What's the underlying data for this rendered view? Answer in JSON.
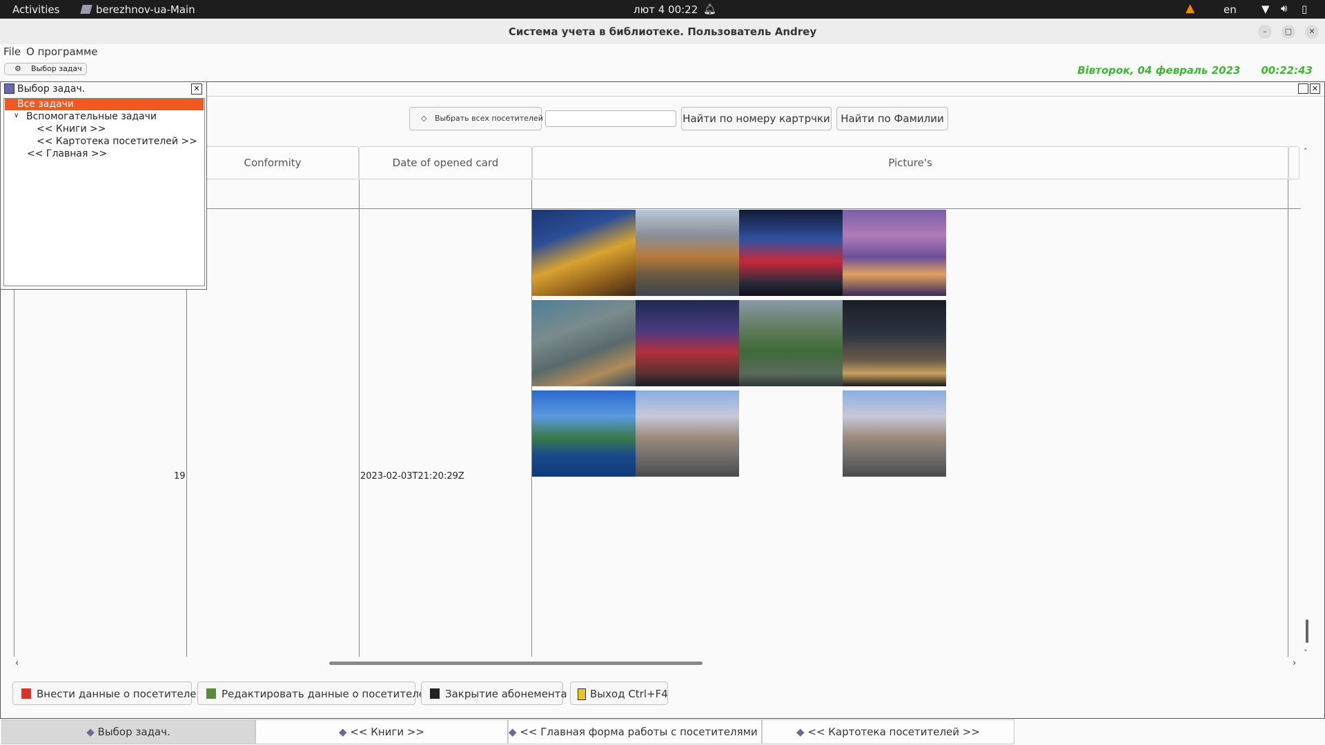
{
  "system": {
    "activities": "Activities",
    "app_name": "berezhnov-ua-Main",
    "clock": "лют 4  00:22",
    "keyboard_layout": "en"
  },
  "window": {
    "title": "Система учета в библиотеке. Пользователь Andrey"
  },
  "menu": {
    "file": "File",
    "about": "О программе"
  },
  "toolbar": {
    "task_select_label": "Выбор задач",
    "date": "Вівторок, 04 февраль 2023",
    "time": "00:22:43"
  },
  "task_panel": {
    "title": "Выбор задач.",
    "items": [
      {
        "label": "Все задачи",
        "selected": true
      },
      {
        "label": "Вспомогательные задачи"
      },
      {
        "label": "<< Книги >>"
      },
      {
        "label": "<< Картотека посетителей >>"
      },
      {
        "label": "<< Главная >>"
      }
    ]
  },
  "search": {
    "select_all_label": "Выбрать всех посетителей",
    "input_value": "",
    "find_by_card_label": "Найти по номеру картрчки",
    "find_by_surname_label": "Найти по Фамилии"
  },
  "table": {
    "headers": [
      "Conformity",
      "Date of opened card",
      "Picture's"
    ],
    "row": {
      "id": "19",
      "date": "2023-02-03T21:20:29Z"
    }
  },
  "actions": {
    "add_label": "Внести данные о посетителе",
    "edit_label": "Редактировать данные о посетителе",
    "close_label": "Закрытие абонемента",
    "exit_label": "Выход Ctrl+F4"
  },
  "tabs": [
    {
      "label": "Выбор задач.",
      "active": true
    },
    {
      "label": "<< Книги >>"
    },
    {
      "label": "<< Главная форма работы с посетителями >>"
    },
    {
      "label": "<< Картотека посетителей >>"
    }
  ],
  "colors": {
    "accent": "#f05a22",
    "datetime": "#3cb832"
  }
}
